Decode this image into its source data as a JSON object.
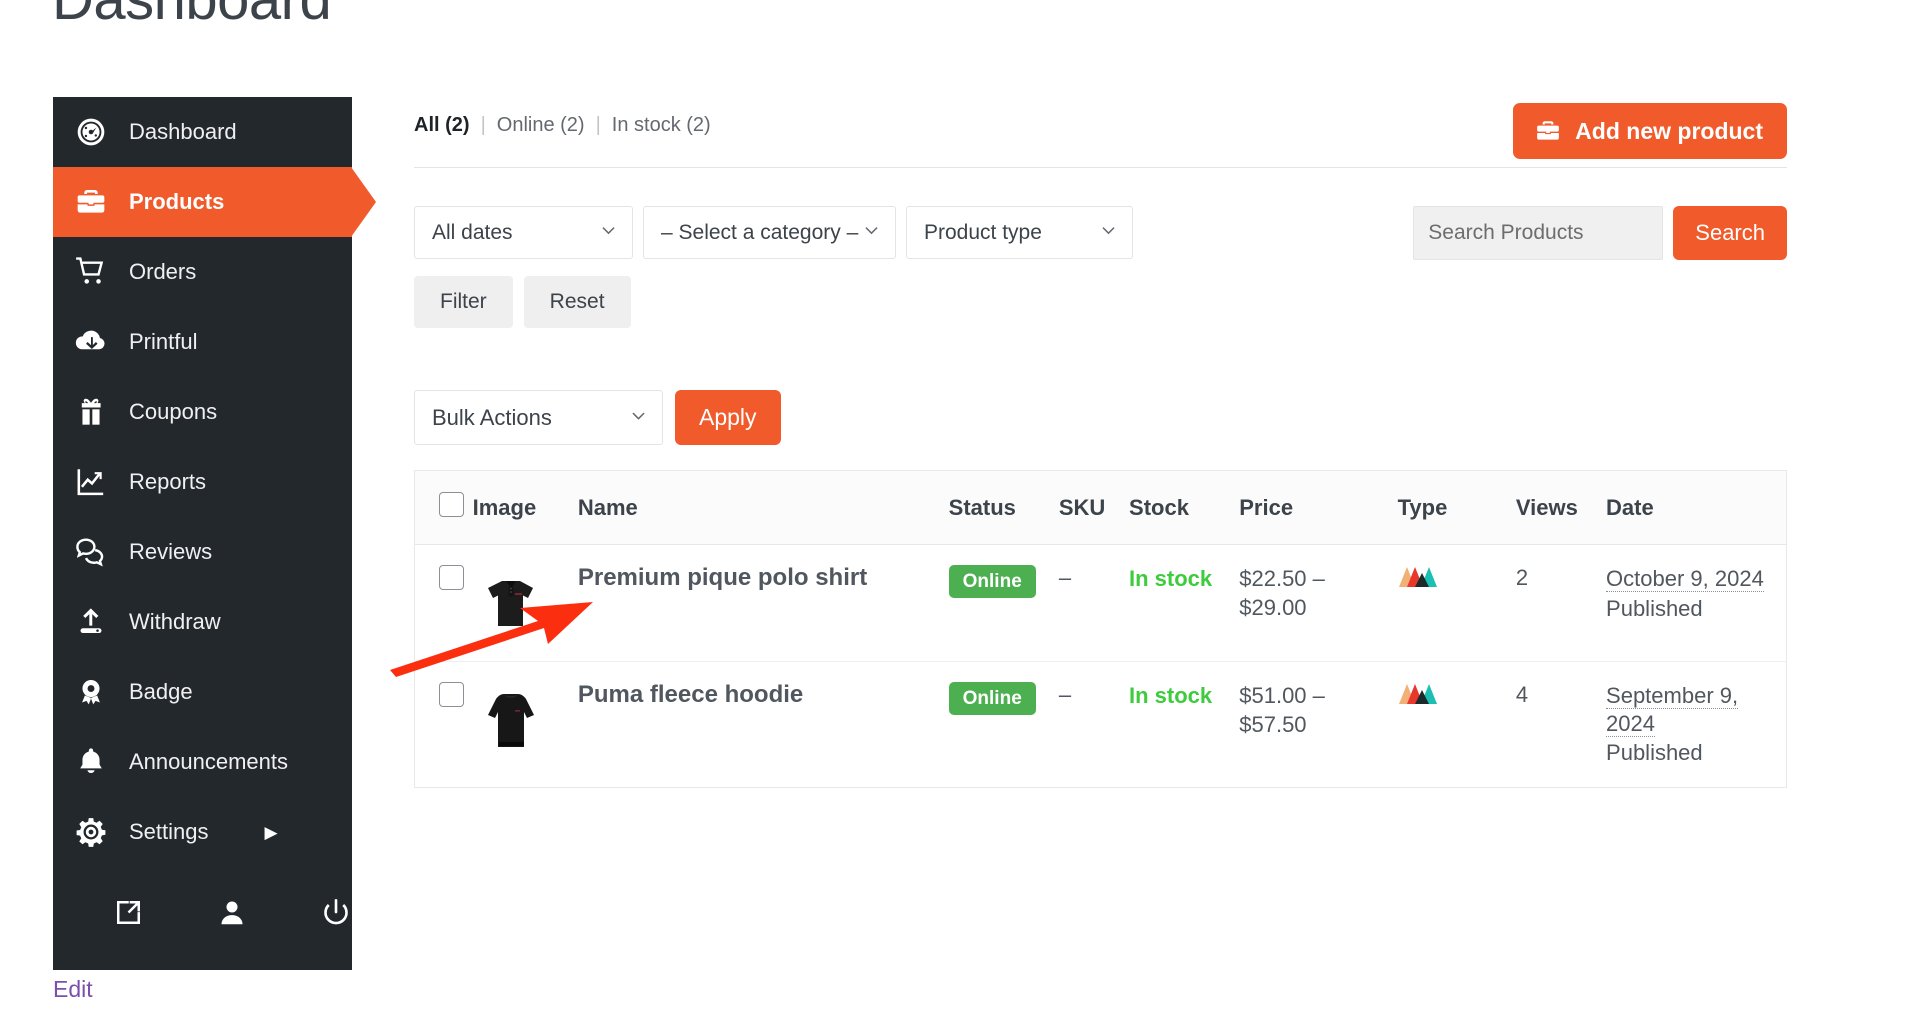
{
  "page": {
    "title": "Dashboard",
    "edit_link": "Edit"
  },
  "sidebar": {
    "items": [
      {
        "label": "Dashboard",
        "icon": "speedometer-icon",
        "active": false
      },
      {
        "label": "Products",
        "icon": "briefcase-icon",
        "active": true
      },
      {
        "label": "Orders",
        "icon": "shopping-cart-icon",
        "active": false
      },
      {
        "label": "Printful",
        "icon": "cloud-download-icon",
        "active": false
      },
      {
        "label": "Coupons",
        "icon": "gift-icon",
        "active": false
      },
      {
        "label": "Reports",
        "icon": "chart-line-icon",
        "active": false
      },
      {
        "label": "Reviews",
        "icon": "comments-icon",
        "active": false
      },
      {
        "label": "Withdraw",
        "icon": "upload-icon",
        "active": false
      },
      {
        "label": "Badge",
        "icon": "award-icon",
        "active": false
      },
      {
        "label": "Announcements",
        "icon": "bell-icon",
        "active": false
      },
      {
        "label": "Settings",
        "icon": "gear-icon",
        "active": false,
        "submenu_arrow": "▶"
      }
    ],
    "bottom_icons": [
      {
        "name": "external-link-icon"
      },
      {
        "name": "user-icon"
      },
      {
        "name": "power-icon"
      }
    ],
    "colors": {
      "background": "#23282d",
      "active": "#f15a2b"
    }
  },
  "views": {
    "all": "All (2)",
    "online": "Online (2)",
    "in_stock": "In stock (2)",
    "separator": "|"
  },
  "toolbar": {
    "add_new_product": "Add new product",
    "add_icon": "briefcase-icon"
  },
  "filters": {
    "dates": "All dates",
    "category": "– Select a category –",
    "product_type": "Product type",
    "filter_button": "Filter",
    "reset_button": "Reset"
  },
  "search": {
    "placeholder": "Search Products",
    "value": "",
    "button": "Search"
  },
  "bulk": {
    "select": "Bulk Actions",
    "apply": "Apply"
  },
  "table": {
    "headers": {
      "image": "Image",
      "name": "Name",
      "status": "Status",
      "sku": "SKU",
      "stock": "Stock",
      "price": "Price",
      "type": "Type",
      "views": "Views",
      "date": "Date"
    },
    "rows": [
      {
        "name": "Premium pique polo shirt",
        "image_alt": "black-polo-shirt-thumbnail",
        "status": "Online",
        "sku": "–",
        "stock": "In stock",
        "price": "$22.50 – $29.00",
        "type_icon": "printful-mountains-icon",
        "views": "2",
        "date": "October 9, 2024",
        "date_status": "Published"
      },
      {
        "name": "Puma fleece hoodie",
        "image_alt": "black-hoodie-thumbnail",
        "status": "Online",
        "sku": "–",
        "stock": "In stock",
        "price": "$51.00 – $57.50",
        "type_icon": "printful-mountains-icon",
        "views": "4",
        "date": "September 9, 2024",
        "date_status": "Published"
      }
    ]
  },
  "annotation": {
    "arrow_color": "#fb2f10"
  },
  "colors": {
    "accent": "#f15a2b",
    "badge_green": "#4caf50",
    "stock_green": "#3ecb3e",
    "sidebar_dark": "#23282d",
    "edit_purple": "#7b4fab"
  }
}
